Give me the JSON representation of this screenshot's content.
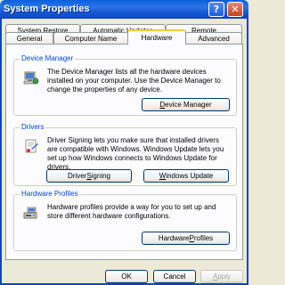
{
  "window": {
    "title": "System Properties"
  },
  "title_buttons": {
    "help": "?",
    "close": "✕"
  },
  "tabs_back": [
    "System Restore",
    "Automatic Updates",
    "Remote"
  ],
  "tabs_front": [
    "General",
    "Computer Name",
    "Hardware",
    "Advanced"
  ],
  "active_tab": "Hardware",
  "device_manager": {
    "title": "Device Manager",
    "description": "The Device Manager lists all the hardware devices installed on your computer. Use the Device Manager to change the properties of any device.",
    "button": {
      "pre": "",
      "key": "D",
      "post": "evice Manager"
    }
  },
  "drivers": {
    "title": "Drivers",
    "description": "Driver Signing lets you make sure that installed drivers are compatible with Windows. Windows Update lets you set up how Windows connects to Windows Update for drivers.",
    "signing_button": {
      "pre": "Driver ",
      "key": "S",
      "post": "igning"
    },
    "update_button": {
      "pre": "",
      "key": "W",
      "post": "indows Update"
    }
  },
  "hardware_profiles": {
    "title": "Hardware Profiles",
    "description": "Hardware profiles provide a way for you to set up and store different hardware configurations.",
    "button": {
      "pre": "Hardware ",
      "key": "P",
      "post": "rofiles"
    }
  },
  "footer": {
    "ok": "OK",
    "cancel": "Cancel",
    "apply": {
      "pre": "",
      "key": "A",
      "post": "pply"
    }
  }
}
